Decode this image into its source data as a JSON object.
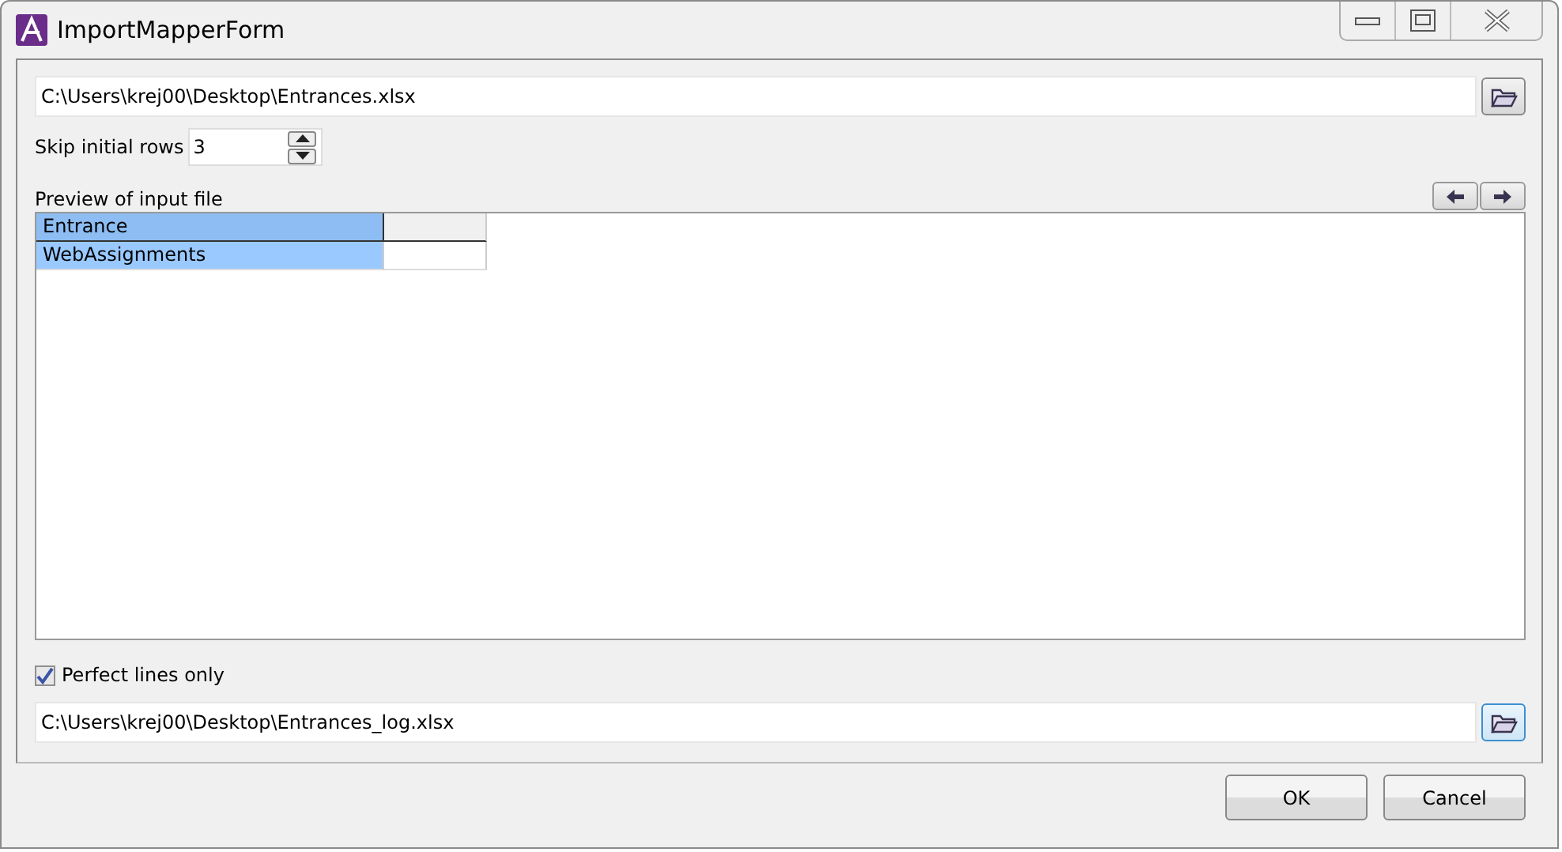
{
  "window": {
    "title": "ImportMapperForm"
  },
  "input_file": {
    "value": "C:\\Users\\krej00\\Desktop\\Entrances.xlsx",
    "browse_focused": false
  },
  "skip_rows": {
    "label": "Skip initial rows",
    "value": "3"
  },
  "preview": {
    "label": "Preview of input file",
    "rows": [
      {
        "cells": [
          "Entrance",
          ""
        ],
        "header": true
      },
      {
        "cells": [
          "WebAssignments",
          ""
        ],
        "header": false
      }
    ]
  },
  "perfect_lines": {
    "label": "Perfect lines only",
    "checked": true
  },
  "log_file": {
    "value": "C:\\Users\\krej00\\Desktop\\Entrances_log.xlsx",
    "browse_focused": true
  },
  "buttons": [
    "OK",
    "Cancel"
  ]
}
